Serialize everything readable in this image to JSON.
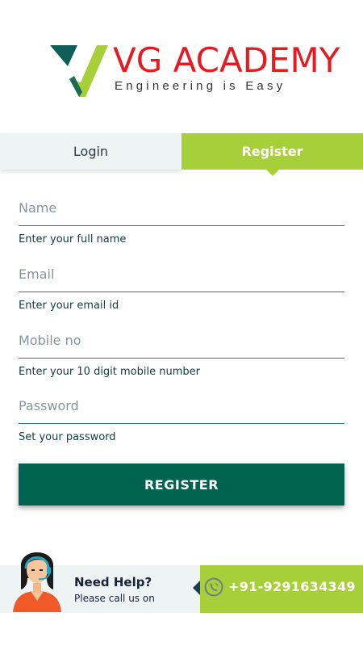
{
  "logo": {
    "title": "VG ACADEMY",
    "tagline": "Engineering is Easy"
  },
  "tabs": [
    {
      "label": "Login",
      "active": false
    },
    {
      "label": "Register",
      "active": true
    }
  ],
  "form": {
    "name": {
      "placeholder": "Name",
      "hint": "Enter your full name"
    },
    "email": {
      "placeholder": "Email",
      "hint": "Enter your email id"
    },
    "mobile": {
      "placeholder": "Mobile no",
      "hint": "Enter your 10 digit mobile number"
    },
    "password": {
      "placeholder": "Password",
      "hint": "Set your password"
    },
    "submit_label": "REGISTER"
  },
  "help": {
    "title": "Need Help?",
    "subtitle": "Please call us on",
    "phone": "+91-9291634349",
    "icon": "phone-icon"
  },
  "colors": {
    "brand_red": "#e31b23",
    "accent_green": "#a6cf39",
    "primary_dark": "#006350"
  }
}
